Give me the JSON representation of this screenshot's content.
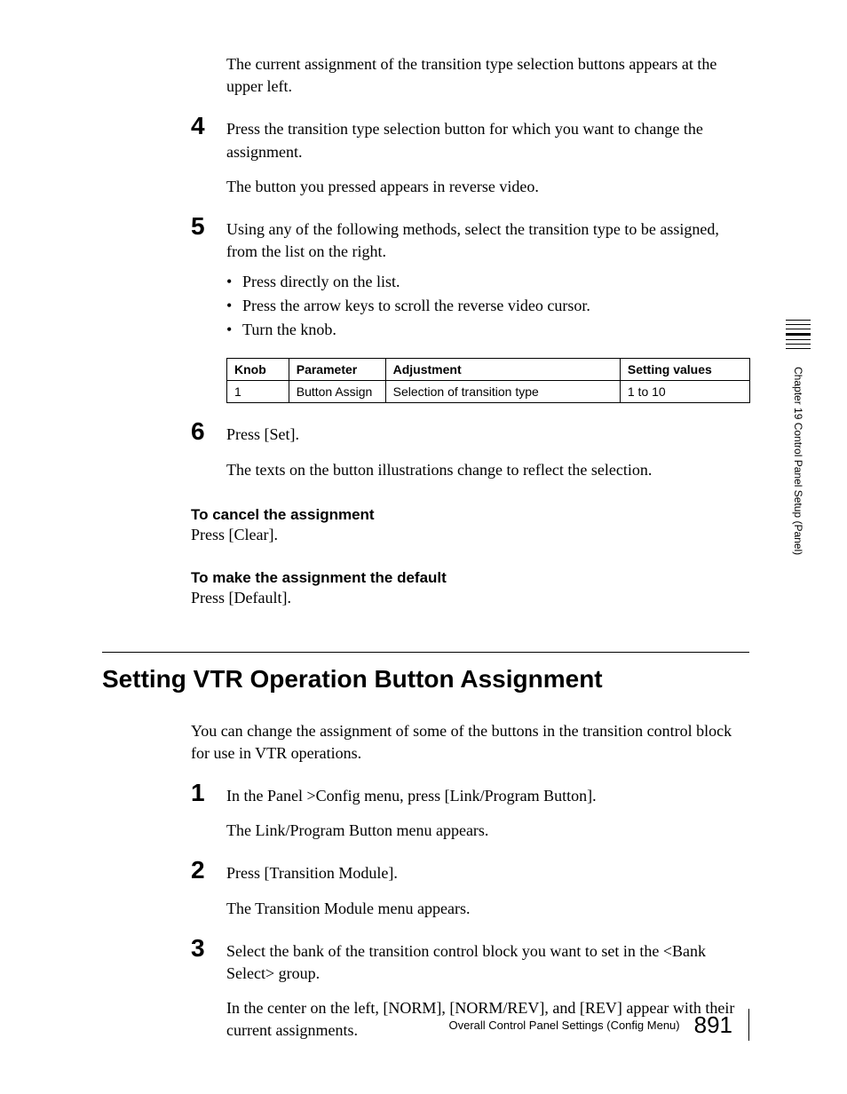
{
  "intro_para": "The current assignment of the transition type selection buttons appears at the upper left.",
  "step4": {
    "num": "4",
    "text": "Press the transition type selection button for which you want to change the assignment.",
    "follow": "The button you pressed appears in reverse video."
  },
  "step5": {
    "num": "5",
    "text": "Using any of the following methods, select the transition type to be assigned, from the list on the right.",
    "bullets": [
      "Press directly on the list.",
      "Press the arrow keys to scroll the reverse video cursor.",
      "Turn the knob."
    ]
  },
  "table": {
    "headers": [
      "Knob",
      "Parameter",
      "Adjustment",
      "Setting values"
    ],
    "row": [
      "1",
      "Button Assign",
      "Selection of transition type",
      "1 to 10"
    ]
  },
  "step6": {
    "num": "6",
    "text": "Press [Set].",
    "follow": "The texts on the button illustrations change to reflect the selection."
  },
  "cancel": {
    "heading": "To cancel the assignment",
    "text": "Press [Clear]."
  },
  "default": {
    "heading": "To make the assignment the default",
    "text": "Press [Default]."
  },
  "section_heading": "Setting VTR Operation Button Assignment",
  "section_intro": "You can change the assignment of some of the buttons in the transition control block for use in VTR operations.",
  "vstep1": {
    "num": "1",
    "text": "In the Panel >Config menu, press [Link/Program Button].",
    "follow": "The Link/Program Button menu appears."
  },
  "vstep2": {
    "num": "2",
    "text": "Press [Transition Module].",
    "follow": "The Transition Module menu appears."
  },
  "vstep3": {
    "num": "3",
    "text": "Select the bank of the transition control block you want to set in the <Bank Select> group.",
    "follow": "In the center on the left, [NORM], [NORM/REV], and [REV] appear with their current assignments."
  },
  "side_text": "Chapter 19   Control Panel Setup (Panel)",
  "footer_text": "Overall Control Panel Settings (Config Menu)",
  "footer_page": "891"
}
